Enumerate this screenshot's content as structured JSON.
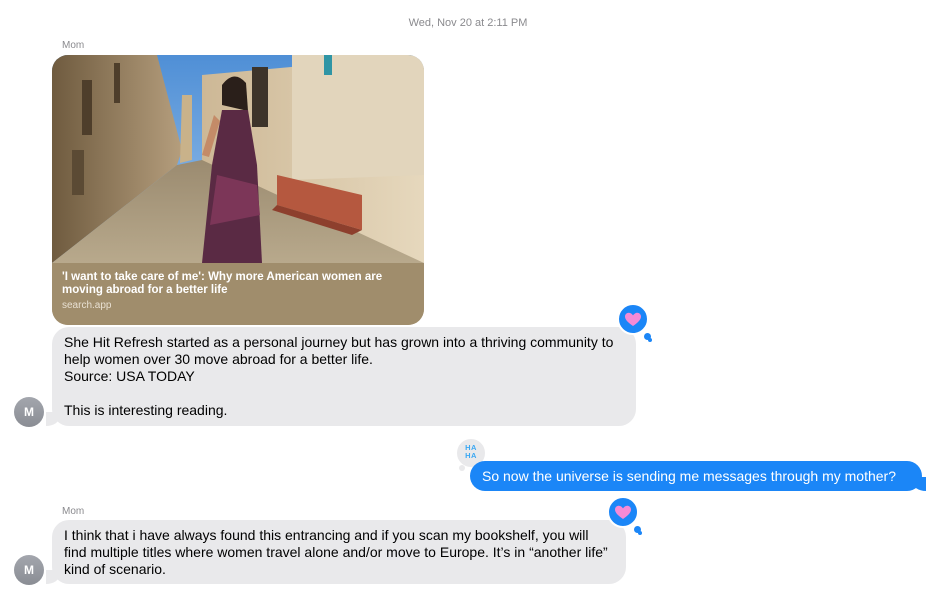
{
  "timestamp": "Wed, Nov 20 at 2:11 PM",
  "thread": {
    "sender_name": "Mom",
    "avatar_initial": "M",
    "link_preview": {
      "title": "'I want to take care of me': Why more American women are moving abroad for a better life",
      "domain": "search.app"
    },
    "message_1": "She Hit Refresh started as a personal journey but has grown into a thriving community to help women over 30 move abroad for a better life.\n Source: USA TODAY\n\nThis is interesting reading.",
    "reply": {
      "text": "So now the universe is sending me messages through my mother?",
      "reaction_line1": "HA",
      "reaction_line2": "HA"
    },
    "message_2": "I think that i have always found this entrancing and if you scan my bookshelf, you will find multiple titles where women travel alone and/or move to Europe. It’s in “another life” kind of scenario."
  },
  "colors": {
    "incoming_bubble": "#e9e9eb",
    "outgoing_bubble": "#1b86f7",
    "heart": "#f58ad6",
    "meta_text": "#8a8a8e"
  },
  "icons": [
    "heart-icon",
    "haha-icon",
    "avatar"
  ]
}
